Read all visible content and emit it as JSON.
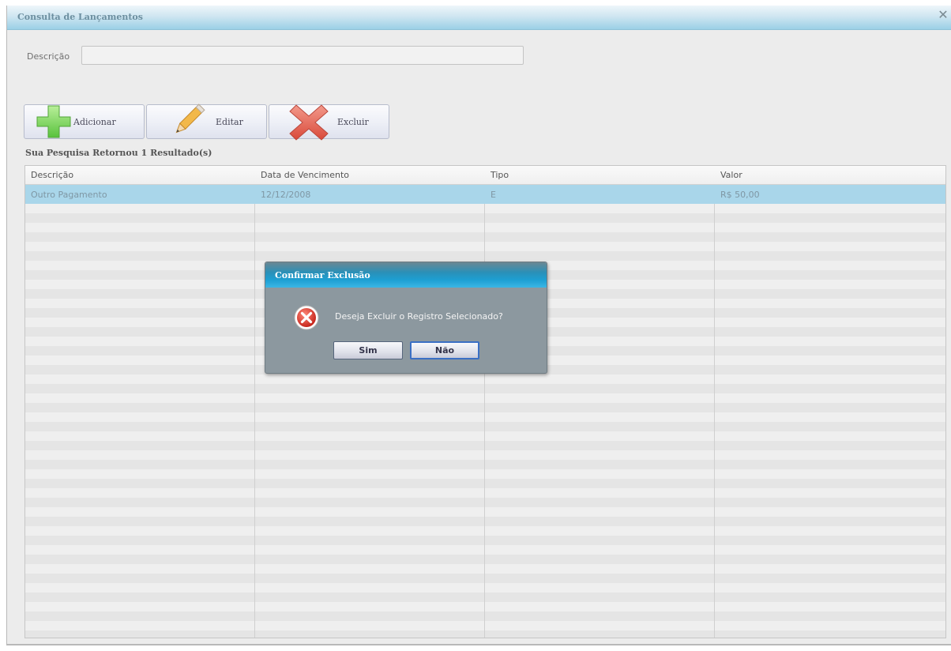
{
  "window": {
    "title": "Consulta de Lançamentos"
  },
  "search": {
    "label": "Descrição",
    "value": ""
  },
  "toolbar": {
    "add_label": "Adicionar",
    "edit_label": "Editar",
    "delete_label": "Excluir"
  },
  "results": {
    "summary": "Sua Pesquisa Retornou 1 Resultado(s)"
  },
  "grid": {
    "columns": [
      "Descrição",
      "Data de Vencimento",
      "Tipo",
      "Valor"
    ],
    "rows": [
      {
        "descricao": "Outro Pagamento",
        "vencimento": "12/12/2008",
        "tipo": "E",
        "valor": "R$ 50,00"
      }
    ]
  },
  "dialog": {
    "title": "Confirmar Exclusão",
    "message": "Deseja Excluir o Registro Selecionado?",
    "yes_label": "Sim",
    "no_label": "Não",
    "icon": "error-icon"
  },
  "colors": {
    "title_gradient": "#9bd0e6",
    "selected_row": "#a9d6ea",
    "dialog_body": "#8c989f",
    "dialog_title": "#1d9fd3"
  }
}
